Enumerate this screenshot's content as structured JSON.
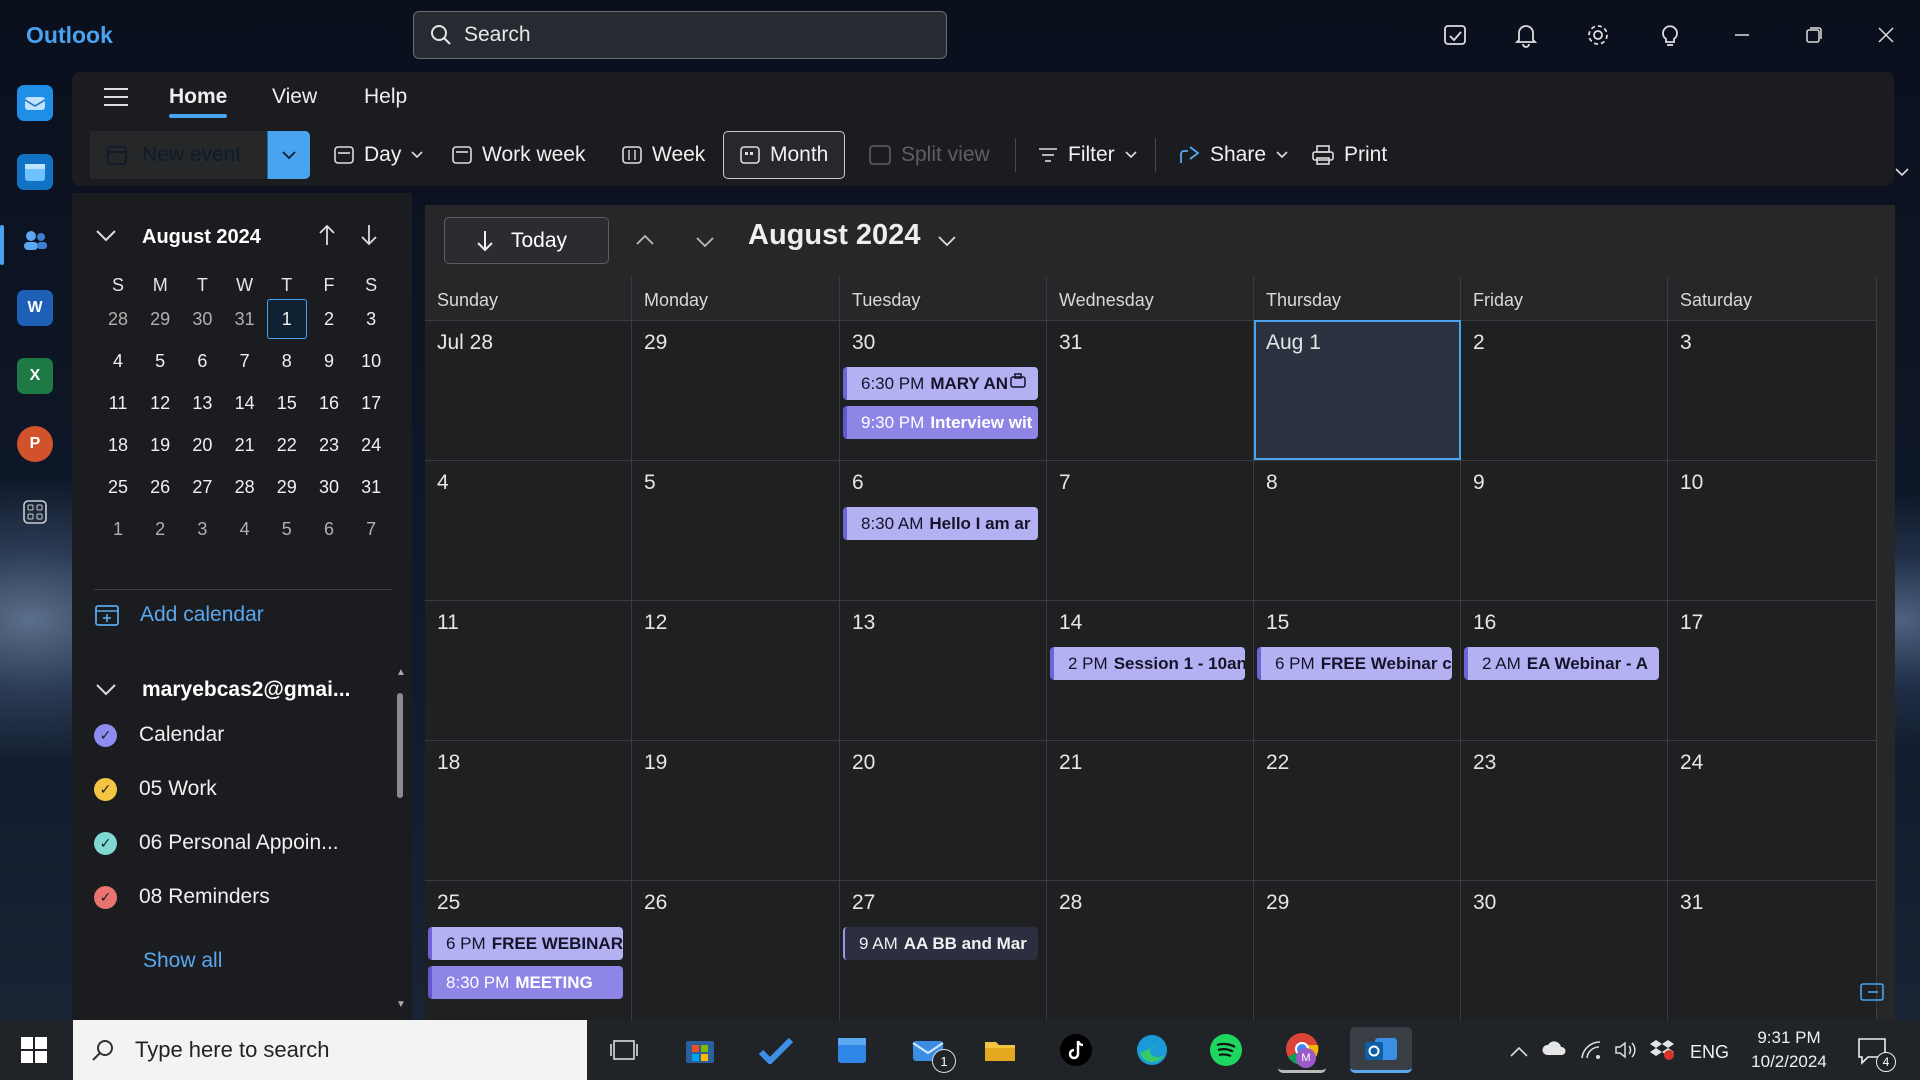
{
  "app": {
    "name": "Outlook"
  },
  "search": {
    "placeholder": "Search"
  },
  "title_icons": [
    "todo-icon",
    "bell-icon",
    "gear-icon",
    "lightbulb-icon",
    "minimize-icon",
    "restore-icon",
    "close-icon"
  ],
  "menu": {
    "home": "Home",
    "view": "View",
    "help": "Help"
  },
  "toolbar": {
    "new_event": "New event",
    "day": "Day",
    "work_week": "Work week",
    "week": "Week",
    "month": "Month",
    "split_view": "Split view",
    "filter": "Filter",
    "share": "Share",
    "print": "Print"
  },
  "mini_cal": {
    "title": "August 2024",
    "headers": [
      "S",
      "M",
      "T",
      "W",
      "T",
      "F",
      "S"
    ],
    "weeks": [
      [
        "28",
        "29",
        "30",
        "31",
        "1",
        "2",
        "3"
      ],
      [
        "4",
        "5",
        "6",
        "7",
        "8",
        "9",
        "10"
      ],
      [
        "11",
        "12",
        "13",
        "14",
        "15",
        "16",
        "17"
      ],
      [
        "18",
        "19",
        "20",
        "21",
        "22",
        "23",
        "24"
      ],
      [
        "25",
        "26",
        "27",
        "28",
        "29",
        "30",
        "31"
      ],
      [
        "1",
        "2",
        "3",
        "4",
        "5",
        "6",
        "7"
      ]
    ]
  },
  "sidebar": {
    "add_calendar": "Add calendar",
    "account": "maryebcas2@gmai...",
    "calendars": [
      {
        "name": "Calendar",
        "color": "#8f8cf0"
      },
      {
        "name": "05 Work",
        "color": "#f4c542"
      },
      {
        "name": "06 Personal Appoin...",
        "color": "#7fd8d3"
      },
      {
        "name": "08 Reminders",
        "color": "#e9736f"
      }
    ],
    "show_all": "Show all"
  },
  "calendar": {
    "today": "Today",
    "title": "August 2024",
    "day_headers": [
      "Sunday",
      "Monday",
      "Tuesday",
      "Wednesday",
      "Thursday",
      "Friday",
      "Saturday"
    ],
    "weeks": [
      [
        "Jul 28",
        "29",
        "30",
        "31",
        "Aug 1",
        "2",
        "3"
      ],
      [
        "4",
        "5",
        "6",
        "7",
        "8",
        "9",
        "10"
      ],
      [
        "11",
        "12",
        "13",
        "14",
        "15",
        "16",
        "17"
      ],
      [
        "18",
        "19",
        "20",
        "21",
        "22",
        "23",
        "24"
      ],
      [
        "25",
        "26",
        "27",
        "28",
        "29",
        "30",
        "31"
      ]
    ],
    "events": [
      {
        "week": 0,
        "day": 2,
        "slot": 0,
        "time": "6:30 PM",
        "title": "MARY AN",
        "style": "light"
      },
      {
        "week": 0,
        "day": 2,
        "slot": 1,
        "time": "9:30 PM",
        "title": "Interview wit",
        "style": "violet"
      },
      {
        "week": 1,
        "day": 2,
        "slot": 0,
        "time": "8:30 AM",
        "title": "Hello I am ar",
        "style": "light"
      },
      {
        "week": 2,
        "day": 3,
        "slot": 0,
        "time": "2 PM",
        "title": "Session 1 - 10an",
        "style": "light"
      },
      {
        "week": 2,
        "day": 4,
        "slot": 0,
        "time": "6 PM",
        "title": "FREE Webinar c",
        "style": "light"
      },
      {
        "week": 2,
        "day": 5,
        "slot": 0,
        "time": "2 AM",
        "title": "EA Webinar - A",
        "style": "light"
      },
      {
        "week": 4,
        "day": 0,
        "slot": 0,
        "time": "6 PM",
        "title": "FREE WEBINAR",
        "style": "light"
      },
      {
        "week": 4,
        "day": 0,
        "slot": 1,
        "time": "8:30 PM",
        "title": "MEETING",
        "style": "violet"
      },
      {
        "week": 4,
        "day": 2,
        "slot": 0,
        "time": "9 AM",
        "title": "AA BB and Mar",
        "style": "dark"
      }
    ]
  },
  "taskbar": {
    "search_placeholder": "Type here to search",
    "mail_badge": "1",
    "lang": "ENG",
    "time": "9:31 PM",
    "date": "10/2/2024",
    "notif_count": "4"
  }
}
